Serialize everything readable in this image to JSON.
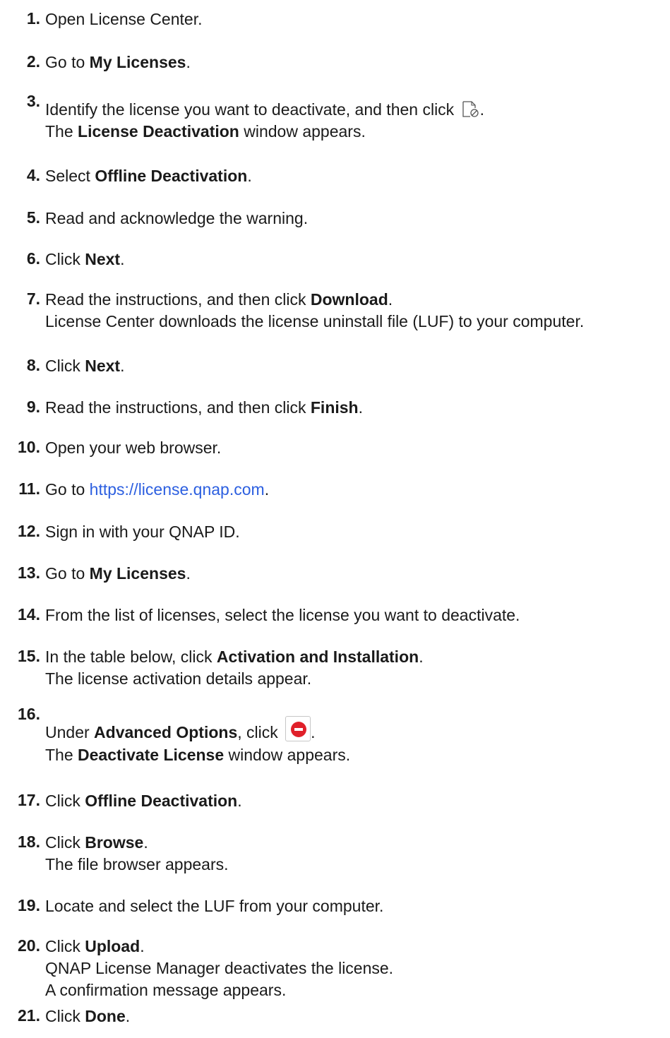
{
  "steps": [
    {
      "num": "1.",
      "lines": [
        [
          "Open License Center."
        ]
      ]
    },
    {
      "num": "2.",
      "lines": [
        [
          "Go to ",
          {
            "b": "My Licenses"
          },
          "."
        ]
      ]
    },
    {
      "num": "3.",
      "lines": [
        [
          "Identify the license you want to deactivate, and then click ",
          {
            "icon": "license-deactivate-icon"
          },
          "."
        ],
        [
          "The ",
          {
            "b": "License Deactivation"
          },
          " window appears."
        ]
      ]
    },
    {
      "num": "4.",
      "lines": [
        [
          "Select ",
          {
            "b": "Offline Deactivation"
          },
          "."
        ]
      ]
    },
    {
      "num": "5.",
      "lines": [
        [
          "Read and acknowledge the warning."
        ]
      ]
    },
    {
      "num": "6.",
      "lines": [
        [
          "Click ",
          {
            "b": "Next"
          },
          "."
        ]
      ]
    },
    {
      "num": "7.",
      "lines": [
        [
          "Read the instructions, and then click ",
          {
            "b": "Download"
          },
          "."
        ],
        [
          "License Center downloads the license uninstall file (LUF) to your computer."
        ]
      ]
    },
    {
      "num": "8.",
      "lines": [
        [
          "Click ",
          {
            "b": "Next"
          },
          "."
        ]
      ]
    },
    {
      "num": "9.",
      "lines": [
        [
          "Read the instructions, and then click ",
          {
            "b": "Finish"
          },
          "."
        ]
      ]
    },
    {
      "num": "10.",
      "lines": [
        [
          "Open your web browser."
        ]
      ]
    },
    {
      "num": "11.",
      "lines": [
        [
          "Go to ",
          {
            "a": "https://license.qnap.com"
          },
          "."
        ]
      ]
    },
    {
      "num": "12.",
      "lines": [
        [
          "Sign in with your QNAP ID."
        ]
      ]
    },
    {
      "num": "13.",
      "lines": [
        [
          "Go to ",
          {
            "b": "My Licenses"
          },
          "."
        ]
      ]
    },
    {
      "num": "14.",
      "lines": [
        [
          "From the list of licenses, select the license you want to deactivate."
        ]
      ]
    },
    {
      "num": "15.",
      "lines": [
        [
          "In the table below, click ",
          {
            "b": "Activation and Installation"
          },
          "."
        ],
        [
          "The license activation details appear."
        ]
      ]
    },
    {
      "num": "16.",
      "lines": [
        [
          "Under ",
          {
            "b": "Advanced Options"
          },
          ", click ",
          {
            "icon": "remove-button-icon"
          },
          "."
        ],
        [
          "The ",
          {
            "b": "Deactivate License"
          },
          " window appears."
        ]
      ]
    },
    {
      "num": "17.",
      "lines": [
        [
          "Click ",
          {
            "b": "Offline Deactivation"
          },
          "."
        ]
      ]
    },
    {
      "num": "18.",
      "lines": [
        [
          "Click ",
          {
            "b": "Browse"
          },
          "."
        ],
        [
          "The file browser appears."
        ]
      ]
    },
    {
      "num": "19.",
      "lines": [
        [
          "Locate and select the LUF from your computer."
        ]
      ]
    },
    {
      "num": "20.",
      "lines": [
        [
          "Click ",
          {
            "b": "Upload"
          },
          "."
        ],
        [
          "QNAP License Manager deactivates the license."
        ],
        [
          "A confirmation message appears."
        ]
      ]
    },
    {
      "num": "21.",
      "lines": [
        [
          "Click ",
          {
            "b": "Done"
          },
          "."
        ]
      ]
    }
  ],
  "colors": {
    "text": "#1a1a1a",
    "link": "#2c5fe0",
    "remove_icon": "#e0202a"
  }
}
